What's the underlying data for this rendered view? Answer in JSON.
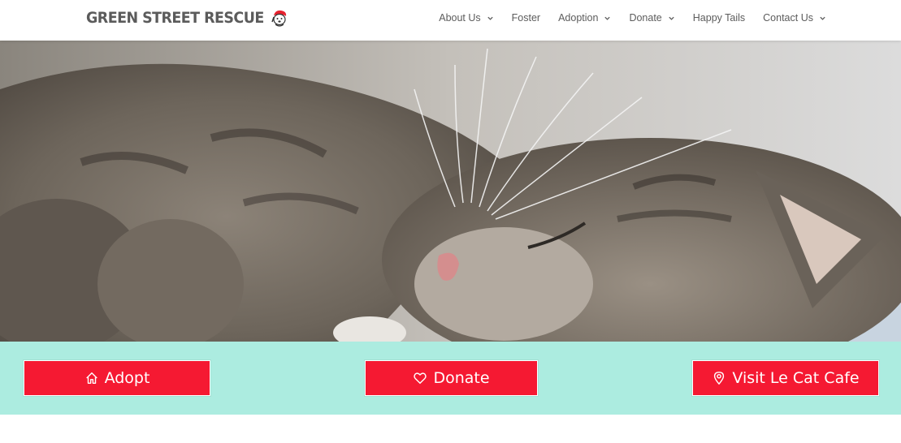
{
  "brand": {
    "name": "GREEN STREET RESCUE",
    "mascot_icon": "dog-mascot-icon"
  },
  "nav": {
    "items": [
      {
        "label": "About Us",
        "has_dropdown": true
      },
      {
        "label": "Foster",
        "has_dropdown": false
      },
      {
        "label": "Adoption",
        "has_dropdown": true
      },
      {
        "label": "Donate",
        "has_dropdown": true
      },
      {
        "label": "Happy Tails",
        "has_dropdown": false
      },
      {
        "label": "Contact Us",
        "has_dropdown": true
      }
    ]
  },
  "hero": {
    "subject": "sleeping tabby cat"
  },
  "cta": {
    "adopt": {
      "label": "Adopt",
      "icon": "home-icon"
    },
    "donate": {
      "label": "Donate",
      "icon": "heart-icon"
    },
    "cafe": {
      "label": "Visit Le Cat Cafe",
      "icon": "map-pin-icon"
    }
  },
  "colors": {
    "accent_red": "#f51932",
    "band_mint": "#acece0",
    "nav_text": "#5c5c5c"
  }
}
